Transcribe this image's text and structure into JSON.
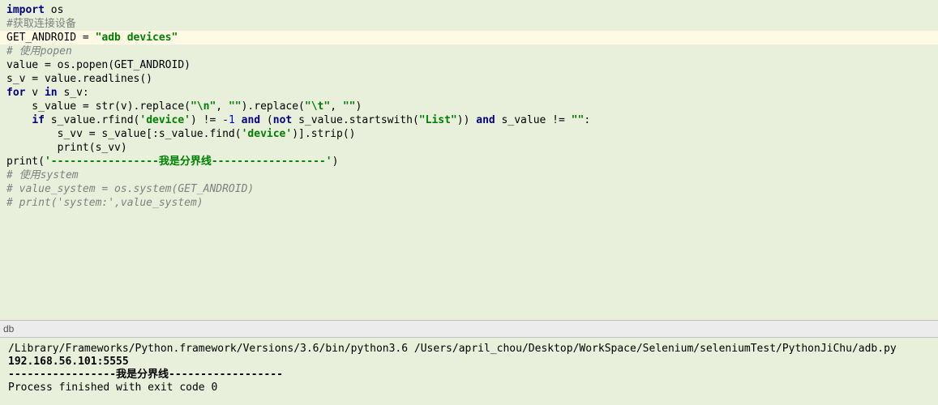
{
  "editor": {
    "l1_kw": "import",
    "l1_mod": " os",
    "l2": "",
    "l3_cm": "#获取连接设备",
    "l4_var": "GET_ANDROID = ",
    "l4_str": "\"adb devices\"",
    "l5": "",
    "l6_cm": "# 使用popen",
    "l7": "value = os.popen(GET_ANDROID)",
    "l8": "s_v = value.readlines()",
    "l9_for": "for",
    "l9_mid": " v ",
    "l9_in": "in",
    "l9_rest": " s_v:",
    "l10_a": "    s_value = str(v).replace(",
    "l10_s1": "\"\\n\"",
    "l10_b": ", ",
    "l10_s2": "\"\"",
    "l10_c": ").replace(",
    "l10_s3": "\"\\t\"",
    "l10_d": ", ",
    "l10_s4": "\"\"",
    "l10_e": ")",
    "l11_indent": "    ",
    "l11_if": "if",
    "l11_a": " s_value.rfind(",
    "l11_s1": "'device'",
    "l11_b": ") != -",
    "l11_num": "1",
    "l11_c": " ",
    "l11_and1": "and",
    "l11_d": " (",
    "l11_not": "not",
    "l11_e": " s_value.startswith(",
    "l11_s2": "\"List\"",
    "l11_f": ")) ",
    "l11_and2": "and",
    "l11_g": " s_value != ",
    "l11_s3": "\"\"",
    "l11_h": ":",
    "l12_a": "        s_vv = s_value[:s_value.find(",
    "l12_s1": "'device'",
    "l12_b": ")].strip()",
    "l13": "        print(s_vv)",
    "l14": "",
    "l15_a": "print(",
    "l15_s": "'-----------------我是分界线------------------'",
    "l15_b": ")",
    "l16": "",
    "l17_cm": "# 使用system",
    "l18_cm": "# value_system = os.system(GET_ANDROID)",
    "l19_cm": "# print('system:',value_system)"
  },
  "tab": {
    "label": "db"
  },
  "console": {
    "cmd": "/Library/Frameworks/Python.framework/Versions/3.6/bin/python3.6 /Users/april_chou/Desktop/WorkSpace/Selenium/seleniumTest/PythonJiChu/adb.py",
    "out1": "192.168.56.101:5555",
    "out2": "-----------------我是分界线------------------",
    "blank": "",
    "exit": "Process finished with exit code 0"
  }
}
